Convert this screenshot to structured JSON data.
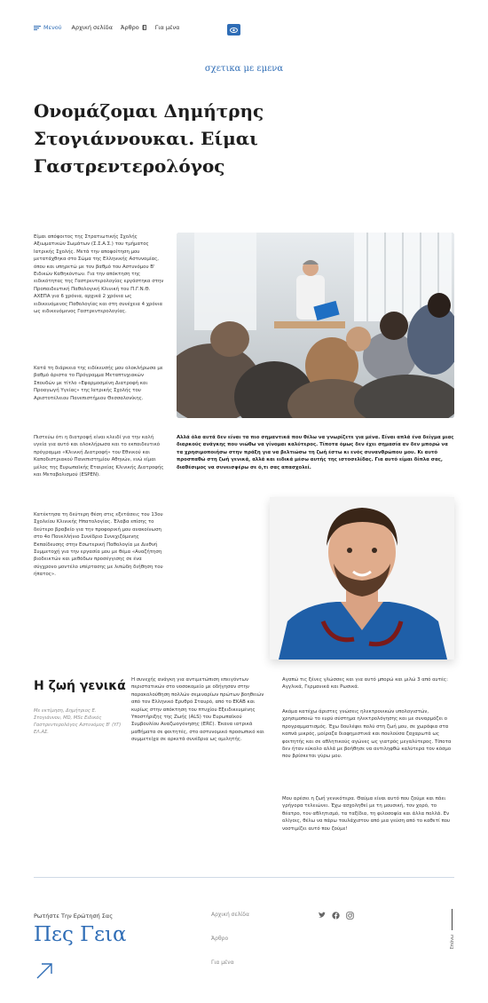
{
  "nav": {
    "menu": "Μενού",
    "home": "Αρχική σελίδα",
    "article": "Άρθρο",
    "about": "Για μένα"
  },
  "eyebrow": "σχετικα με εμενα",
  "hero_title": "Ονομάζομαι Δημήτρης Στογιάννουκαι. Είμαι Γαστρεντερολόγος",
  "left_paragraphs": [
    "Είμαι απόφοιτος της Στρατιωτικής Σχολής Αξιωματικών Σωμάτων (Σ.Σ.Α.Σ.) του τμήματος Ιατρικής Σχολής. Μετά την αποφοίτηση μου μετατάχθηκα στο Σώμα της Ελληνικής Αστυνομίας, όπου και υπηρετώ με τον βαθμό του Αστυνόμου Β' Ειδικών Καθηκόντων. Για την απόκτηση της ειδικότητας της Γαστρεντερολογίας εργάστηκα στην Προπαιδευτική Παθολογική Κλινική του Π.Γ.Ν.Θ. ΑΧΕΠΑ για 6 χρόνια, αρχικά 2 χρόνια ως ειδικευόμενος Παθολογίας και στη συνέχεια 4 χρόνια ως ειδικευόμενος Γαστρεντερολογίας.",
    "Κατά τη διάρκεια της ειδίκευσής μου ολοκλήρωσα με βαθμό άριστα το Πρόγραμμα Μεταπτυχιακών Σπουδών με τίτλο «Εφαρμοσμένη Διατροφή και Προαγωγή Υγείας» της Ιατρικής Σχολής του Αριστοτέλειου Πανεπιστήμιου Θεσσαλονίκης.",
    "Πιστεύω ότι η διατροφή είναι κλειδί για την καλή υγεία για αυτό και ολοκλήρωσα και το εκπαιδευτικό πρόγραμμα «Κλινική Διατροφή» του Εθνικού και Καποδιστριακού Πανεπιστημίου Αθηνών, ενώ είμαι μέλος της Ευρωπαϊκής Εταιρείας Κλινικής Διατροφής και Μεταβολισμού (ESPEN).",
    "Κατέκτησα τη δεύτερη θέση στις εξετάσεις του 13ου Σχολείου Κλινικής Ηπατολογίας. Έλαβα επίσης το δεύτερο βραβείο για την προφορική μου ανακοίνωση στο 4ο Πανελλήνιο Συνέδριο Συνεχιζόμενης Εκπαίδευσης στην Εσωτερική Παθολογία με Διεθνή Συμμετοχή για την εργασία μου με θέμα «Αναζήτηση βιοδεικτών και μεθόδων προσέγγισης σε ένα σύγχρονο μοντέλο υπέρτασης με λιπώδη διήθηση του ήπατος»."
  ],
  "bold_text": "Αλλά όλα αυτά δεν είναι τα πιο σημαντικά που θέλω να γνωρίζετε για μένα. Είναι απλά ένα δείγμα μιας διαρκούς ανάγκης που νιώθω να γίνομαι καλύτερος. Τίποτα όμως δεν έχει σημασία αν δεν μπορώ να τα χρησιμοποιήσω στην πράξη για να βελτιώσω τη ζωή έστω κι ενός συνανθρώπου μου. Κι αυτό προσπαθώ στη ζωή γενικά, αλλά και ειδικά μέσω αυτής της ιστοσελίδας. Για αυτό είμαι δίπλα σας, διαθέσιμος να συνεισφέρω σε ό,τι σας απασχολεί.",
  "life": {
    "title": "Η ζωή γενικά",
    "meta": "Με εκτίμηση, Δημήτριος Ε. Στογιάννου, MD, MSc Ειδικός Γαστρεντερολόγος Αστυνόμος Β' (ΥΓ) ΕΛ.ΑΣ.",
    "middle": "Η συνεχής ανάγκη για αντιμετώπιση επειγόντων περιστατικών στο νοσοκομείο με οδήγησαν στην παρακολούθηση πολλών σεμιναρίων πρώτων βοηθειών από τον Ελληνικό Ερυθρό Σταυρό, από το ΕΚΑΒ και κυρίως στην απόκτηση του πτυχίου Εξειδικευμένης Υποστήριξης της Ζωής (ALS) του Ευρωπαϊκού Συμβουλίου Αναζωογόνησης (ERC). Έκανα ιατρικά μαθήματα σε φοιτητές, στο αστυνομικό προσωπικό και συμμετείχα σε αρκετά συνέδρια ως ομιλητής.",
    "right": [
      "Αγαπώ τις ξένες γλώσσες και για αυτό μπορώ και μιλώ 3 από αυτές: Αγγλικά, Γερμανικά και Ρωσικά.",
      "Ακόμα κατέχω άριστες γνώσεις ηλεκτρονικών υπολογιστών, χρησιμοποιώ το ευρύ σύστημα ηλεκτρολόγησης και με συναρμόζει ο προγραμματισμός. Έχω δουλέψει πολύ στη ζωή μου, σε χωράφια στα καπνά μικρός, μοίραζα διαφημιστικά και πουλούσα ζαχαρωτά ως φοιτητής και σε αθλητικούς αγώνες ως γιατρός μεγαλύτερος. Τίποτα δεν ήταν εύκολο αλλά με βοήθησε να αντιληφθώ καλύτερα τον κόσμο που βρίσκεται γύρω μου.",
      "Μου αρέσει η ζωή γενικότερα. Θαύμα είναι αυτό που ζούμε και πάει γρήγορα τελειώνει. Έχω ασχοληθεί με τη μουσική, τον χορό, το θέατρο, τον αθλητισμό, τα ταξίδια, τη φιλοσοφία και άλλα πολλά. Εν ολίγοις, θέλω να πάρω τουλάχιστον από μια γεύση από το καθετί που νοστιμίζει αυτό που ζούμε!"
    ]
  },
  "footer": {
    "ask": "Ρωτήστε Την Ερώτησή Σας",
    "hello": "Πες Γεια",
    "links": [
      "Αρχική σελίδα",
      "Άρθρο",
      "Για μένα"
    ],
    "socials": [
      "twitter-icon",
      "facebook-icon",
      "instagram-icon"
    ],
    "up": "Επάνω"
  },
  "colors": {
    "accent": "#2f6db6",
    "text": "#2a2a2a"
  }
}
